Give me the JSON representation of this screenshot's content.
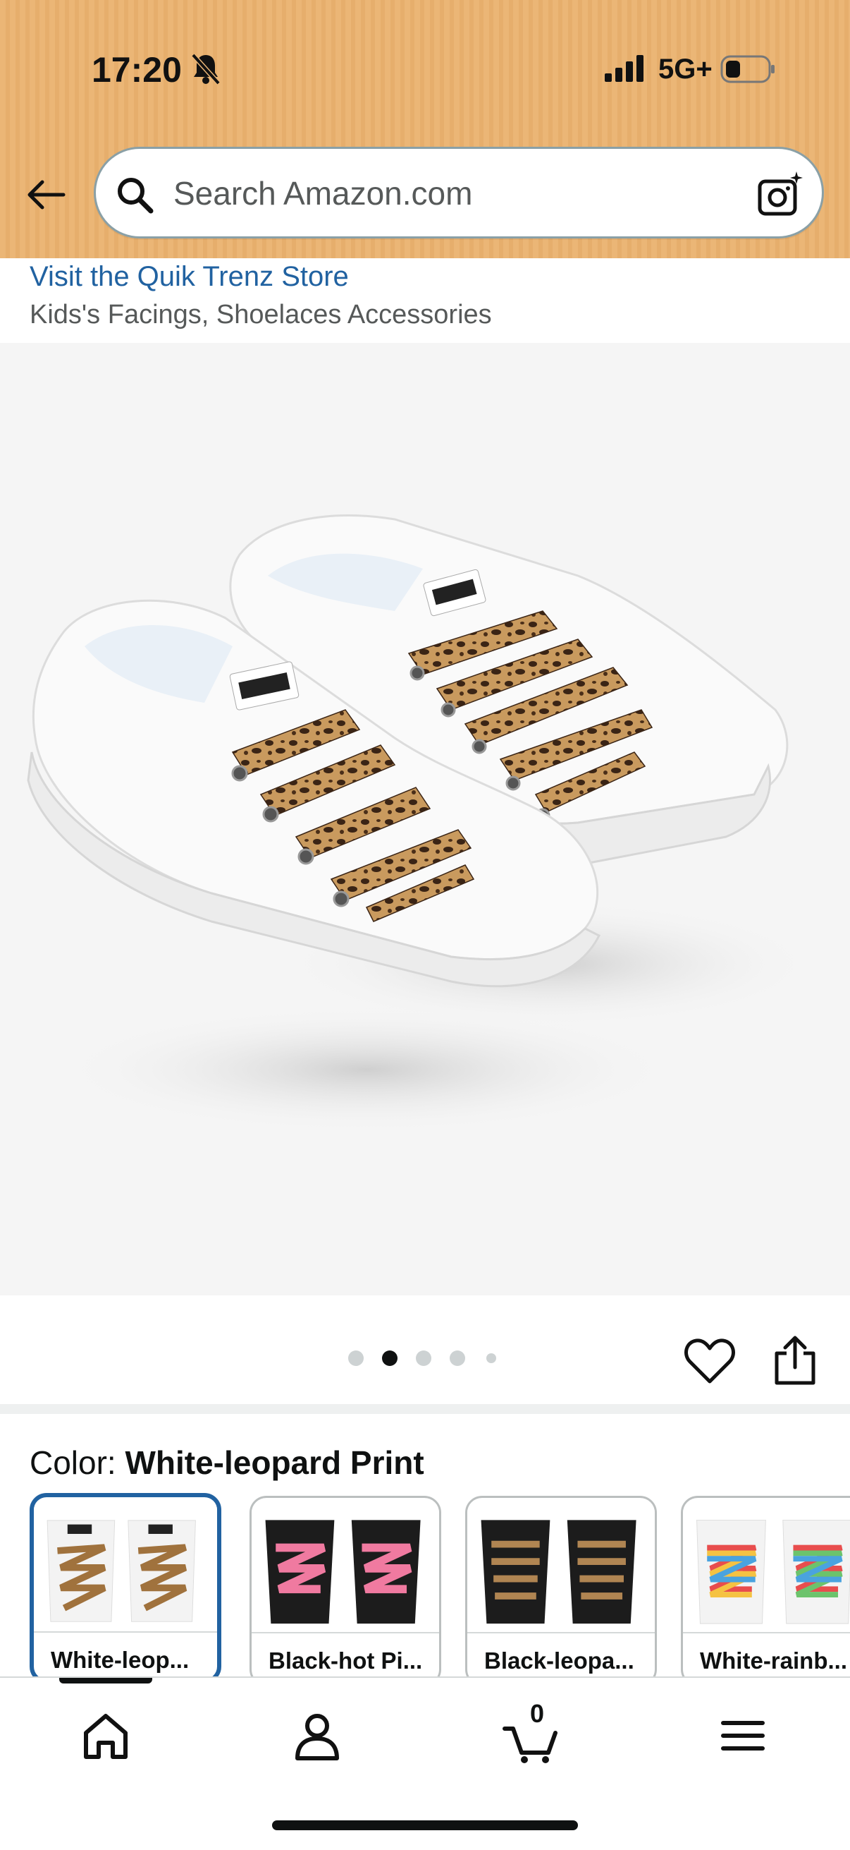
{
  "status_bar": {
    "time": "17:20",
    "network": "5G+",
    "icons": [
      "bell-slash-icon",
      "signal-icon",
      "battery-icon"
    ]
  },
  "search": {
    "placeholder": "Search Amazon.com",
    "value": "",
    "icons": [
      "back-arrow-icon",
      "search-icon",
      "camera-icon"
    ]
  },
  "store": {
    "link": "Visit the Quik Trenz Store",
    "category": "Kids's Facings, Shoelaces Accessories"
  },
  "gallery": {
    "image_alt": "White sneakers with leopard print laces",
    "dot_count": 5,
    "active_index": 1,
    "brand_tag": "Quik Trenz"
  },
  "color": {
    "label": "Color: ",
    "value": "White-leopard Print"
  },
  "swatches": [
    {
      "label": "White-leop...",
      "selected": true
    },
    {
      "label": "Black-hot Pi...",
      "selected": false
    },
    {
      "label": "Black-leopa...",
      "selected": false
    },
    {
      "label": "White-rainb...",
      "selected": false
    }
  ],
  "bottom_nav": {
    "items": [
      "home-icon",
      "account-icon",
      "cart-icon",
      "menu-icon"
    ],
    "cart_count": "0"
  },
  "colors": {
    "header_bg": "#ebb676",
    "link": "#2162a1",
    "selected_border": "#2162a1"
  }
}
